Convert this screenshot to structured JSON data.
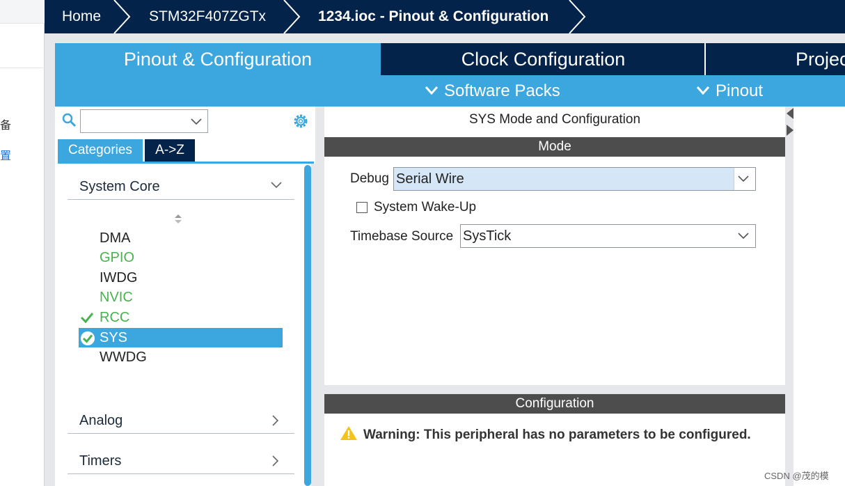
{
  "background_window": {
    "text1": "备",
    "text2": "置"
  },
  "breadcrumb": {
    "items": [
      "Home",
      "STM32F407ZGTx",
      "1234.ioc - Pinout & Configuration"
    ]
  },
  "tabs": {
    "pinout": "Pinout & Configuration",
    "clock": "Clock Configuration",
    "project": "Projec"
  },
  "subbar": {
    "software_packs": "Software Packs",
    "pinout": "Pinout"
  },
  "left_panel": {
    "search": {
      "value": ""
    },
    "category_tabs": [
      "Categories",
      "A->Z"
    ],
    "groups": {
      "system_core": "System Core",
      "analog": "Analog",
      "timers": "Timers"
    },
    "items": [
      {
        "label": "DMA",
        "state": "plain"
      },
      {
        "label": "GPIO",
        "state": "green"
      },
      {
        "label": "IWDG",
        "state": "plain"
      },
      {
        "label": "NVIC",
        "state": "green"
      },
      {
        "label": "RCC",
        "state": "checked"
      },
      {
        "label": "SYS",
        "state": "selected"
      },
      {
        "label": "WWDG",
        "state": "plain"
      }
    ]
  },
  "mode_panel": {
    "title": "SYS Mode and Configuration",
    "mode_header": "Mode",
    "debug": {
      "label": "Debug",
      "value": "Serial Wire"
    },
    "wakeup": {
      "label": "System Wake-Up",
      "checked": false
    },
    "timebase": {
      "label": "Timebase Source",
      "value": "SysTick"
    },
    "config_header": "Configuration",
    "warning": "Warning: This peripheral has no parameters to be configured."
  },
  "watermark": "CSDN @茂的模",
  "colors": {
    "navy": "#03234b",
    "accent_blue": "#3ba7de",
    "green": "#45b44c",
    "section_grey": "#4d4d4d",
    "warning_yellow": "#f4c21b"
  }
}
